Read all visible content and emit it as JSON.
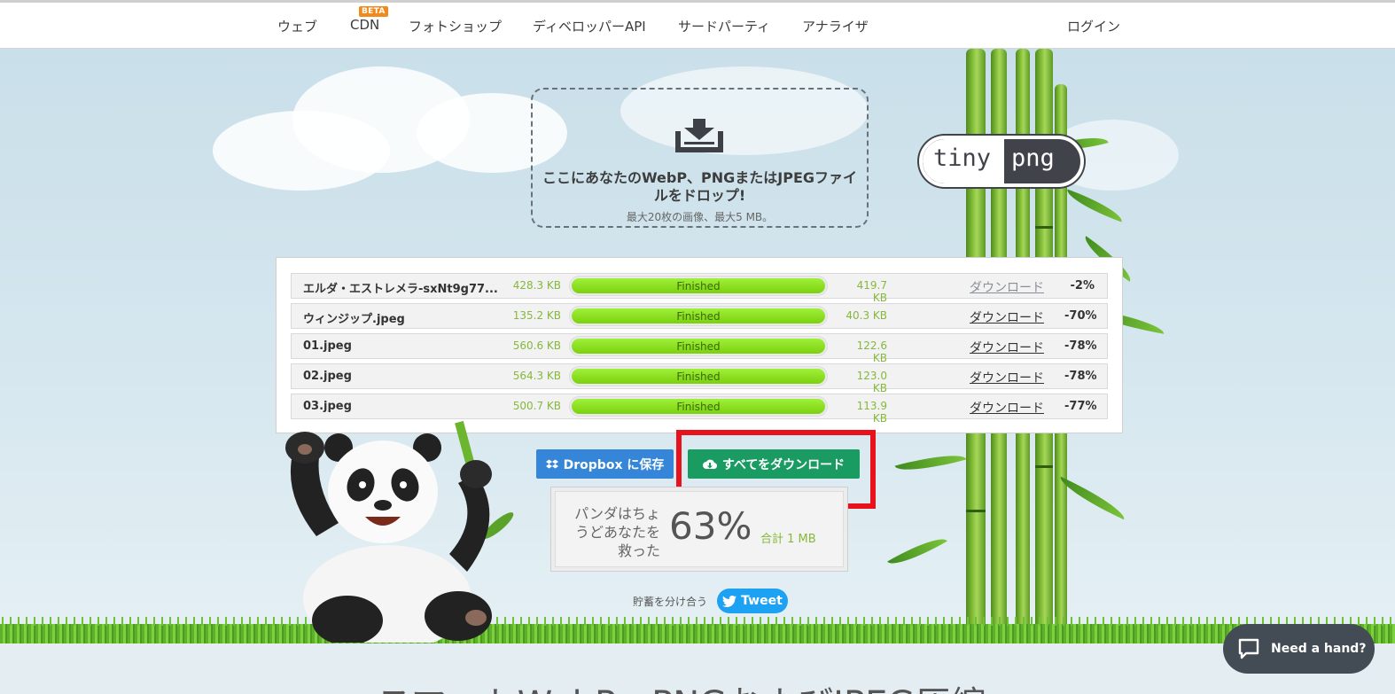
{
  "nav": {
    "items": [
      "ウェブ",
      "CDN",
      "フォトショップ",
      "ディベロッパーAPI",
      "サードパーティ",
      "アナライザ"
    ],
    "beta_badge": "BETA",
    "login": "ログイン"
  },
  "logo": {
    "left": "tiny",
    "right": "png"
  },
  "dropzone": {
    "icon": "tray-download-icon",
    "title": "ここにあなたのWebP、PNGまたはJPEGファイルをドロップ!",
    "subtitle": "最大20枚の画像、最大5 MB。"
  },
  "results": {
    "rows": [
      {
        "name": "エルダ・エストレメラ-sxNt9g77...",
        "original": "428.3 KB",
        "status": "Finished",
        "progress": 1.0,
        "compressed": "419.7 KB",
        "download": "ダウンロード",
        "saving": "-2%"
      },
      {
        "name": "ウィンジップ.jpeg",
        "original": "135.2 KB",
        "status": "Finished",
        "progress": 1.0,
        "compressed": "40.3 KB",
        "download": "ダウンロード",
        "saving": "-70%"
      },
      {
        "name": "01.jpeg",
        "original": "560.6 KB",
        "status": "Finished",
        "progress": 1.0,
        "compressed": "122.6 KB",
        "download": "ダウンロード",
        "saving": "-78%"
      },
      {
        "name": "02.jpeg",
        "original": "564.3 KB",
        "status": "Finished",
        "progress": 1.0,
        "compressed": "123.0 KB",
        "download": "ダウンロード",
        "saving": "-78%"
      },
      {
        "name": "03.jpeg",
        "original": "500.7 KB",
        "status": "Finished",
        "progress": 1.0,
        "compressed": "113.9 KB",
        "download": "ダウンロード",
        "saving": "-77%"
      }
    ]
  },
  "actions": {
    "dropbox_label": "Dropbox に保存",
    "download_all_label": "すべてをダウンロード"
  },
  "savings": {
    "text": "パンダはちょうどあなたを救った",
    "percent": "63%",
    "total": "合計 1 MB"
  },
  "share": {
    "label": "貯蓄を分け合う",
    "tweet": "Tweet"
  },
  "help": {
    "label": "Need a hand?"
  },
  "bottom": {
    "heading": "スマートWebP、PNGおよびJPEG圧縮"
  },
  "colors": {
    "dropbox_blue": "#3586d8",
    "download_green": "#1a9b62",
    "progress_green": "#8be022",
    "highlight_red": "#e8121c",
    "size_green": "#85b83d",
    "tweet_blue": "#1da1f2",
    "help_bg": "#434b54"
  }
}
